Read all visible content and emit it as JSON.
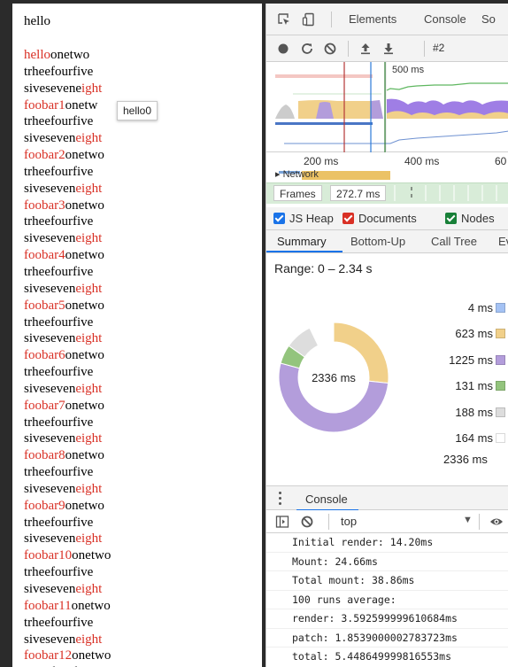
{
  "page": {
    "title": "hello",
    "lines": [
      {
        "parts": [
          {
            "text": "hello",
            "red": true
          },
          {
            "text": "onetwo",
            "red": false
          }
        ]
      },
      {
        "parts": [
          {
            "text": "trheefourfive",
            "red": false
          }
        ]
      },
      {
        "parts": [
          {
            "text": "sivesevene",
            "red": false
          },
          {
            "text": "ight",
            "red": true
          }
        ]
      },
      {
        "parts": [
          {
            "text": "foobar1",
            "red": true
          },
          {
            "text": "onetw",
            "red": false
          }
        ]
      },
      {
        "parts": [
          {
            "text": "trheefourfive",
            "red": false
          }
        ]
      },
      {
        "parts": [
          {
            "text": "siveseven",
            "red": false
          },
          {
            "text": "eight",
            "red": true
          }
        ]
      },
      {
        "parts": [
          {
            "text": "foobar2",
            "red": true
          },
          {
            "text": "onetwo",
            "red": false
          }
        ]
      },
      {
        "parts": [
          {
            "text": "trheefourfive",
            "red": false
          }
        ]
      },
      {
        "parts": [
          {
            "text": "siveseven",
            "red": false
          },
          {
            "text": "eight",
            "red": true
          }
        ]
      },
      {
        "parts": [
          {
            "text": "foobar3",
            "red": true
          },
          {
            "text": "onetwo",
            "red": false
          }
        ]
      },
      {
        "parts": [
          {
            "text": "trheefourfive",
            "red": false
          }
        ]
      },
      {
        "parts": [
          {
            "text": "siveseven",
            "red": false
          },
          {
            "text": "eight",
            "red": true
          }
        ]
      },
      {
        "parts": [
          {
            "text": "foobar4",
            "red": true
          },
          {
            "text": "onetwo",
            "red": false
          }
        ]
      },
      {
        "parts": [
          {
            "text": "trheefourfive",
            "red": false
          }
        ]
      },
      {
        "parts": [
          {
            "text": "siveseven",
            "red": false
          },
          {
            "text": "eight",
            "red": true
          }
        ]
      },
      {
        "parts": [
          {
            "text": "foobar5",
            "red": true
          },
          {
            "text": "onetwo",
            "red": false
          }
        ]
      },
      {
        "parts": [
          {
            "text": "trheefourfive",
            "red": false
          }
        ]
      },
      {
        "parts": [
          {
            "text": "siveseven",
            "red": false
          },
          {
            "text": "eight",
            "red": true
          }
        ]
      },
      {
        "parts": [
          {
            "text": "foobar6",
            "red": true
          },
          {
            "text": "onetwo",
            "red": false
          }
        ]
      },
      {
        "parts": [
          {
            "text": "trheefourfive",
            "red": false
          }
        ]
      },
      {
        "parts": [
          {
            "text": "siveseven",
            "red": false
          },
          {
            "text": "eight",
            "red": true
          }
        ]
      },
      {
        "parts": [
          {
            "text": "foobar7",
            "red": true
          },
          {
            "text": "onetwo",
            "red": false
          }
        ]
      },
      {
        "parts": [
          {
            "text": "trheefourfive",
            "red": false
          }
        ]
      },
      {
        "parts": [
          {
            "text": "siveseven",
            "red": false
          },
          {
            "text": "eight",
            "red": true
          }
        ]
      },
      {
        "parts": [
          {
            "text": "foobar8",
            "red": true
          },
          {
            "text": "onetwo",
            "red": false
          }
        ]
      },
      {
        "parts": [
          {
            "text": "trheefourfive",
            "red": false
          }
        ]
      },
      {
        "parts": [
          {
            "text": "siveseven",
            "red": false
          },
          {
            "text": "eight",
            "red": true
          }
        ]
      },
      {
        "parts": [
          {
            "text": "foobar9",
            "red": true
          },
          {
            "text": "onetwo",
            "red": false
          }
        ]
      },
      {
        "parts": [
          {
            "text": "trheefourfive",
            "red": false
          }
        ]
      },
      {
        "parts": [
          {
            "text": "siveseven",
            "red": false
          },
          {
            "text": "eight",
            "red": true
          }
        ]
      },
      {
        "parts": [
          {
            "text": "foobar10",
            "red": true
          },
          {
            "text": "onetwo",
            "red": false
          }
        ]
      },
      {
        "parts": [
          {
            "text": "trheefourfive",
            "red": false
          }
        ]
      },
      {
        "parts": [
          {
            "text": "siveseven",
            "red": false
          },
          {
            "text": "eight",
            "red": true
          }
        ]
      },
      {
        "parts": [
          {
            "text": "foobar11",
            "red": true
          },
          {
            "text": "onetwo",
            "red": false
          }
        ]
      },
      {
        "parts": [
          {
            "text": "trheefourfive",
            "red": false
          }
        ]
      },
      {
        "parts": [
          {
            "text": "siveseven",
            "red": false
          },
          {
            "text": "eight",
            "red": true
          }
        ]
      },
      {
        "parts": [
          {
            "text": "foobar12",
            "red": true
          },
          {
            "text": "onetwo",
            "red": false
          }
        ]
      },
      {
        "parts": [
          {
            "text": "trheefourfive",
            "red": false
          }
        ]
      }
    ],
    "tooltip": "hello0",
    "red_color": "#d93025"
  },
  "devtools": {
    "tabs": [
      "Elements",
      "Console",
      "So"
    ],
    "icons": [
      "inspect-element-icon",
      "device-toolbar-icon"
    ],
    "perf_toolbar": {
      "icons": [
        "record-icon",
        "reload-icon",
        "clear-icon",
        "upload-icon",
        "download-icon"
      ],
      "recording_label": "#2"
    },
    "overview": {
      "label": "500 ms"
    },
    "ruler": [
      "200 ms",
      "400 ms",
      "60"
    ],
    "network_label": "Network",
    "frames": {
      "label": "Frames",
      "value": "272.7 ms"
    },
    "checkboxes": [
      {
        "label": "JS Heap",
        "color": "#1a73e8"
      },
      {
        "label": "Documents",
        "color": "#d93025"
      },
      {
        "label": "Nodes",
        "color": "#188038"
      }
    ],
    "subtabs": [
      "Summary",
      "Bottom-Up",
      "Call Tree",
      "Ev"
    ],
    "summary": {
      "range": "Range: 0 – 2.34 s",
      "total_center": "2336 ms",
      "legend": [
        {
          "value": "4 ms",
          "ms": 4,
          "color": "#a4c2f4"
        },
        {
          "value": "623 ms",
          "ms": 623,
          "color": "#f1d08a"
        },
        {
          "value": "1225 ms",
          "ms": 1225,
          "color": "#b39ddb"
        },
        {
          "value": "131 ms",
          "ms": 131,
          "color": "#93c47d"
        },
        {
          "value": "188 ms",
          "ms": 188,
          "color": "#dddddd"
        },
        {
          "value": "164 ms",
          "ms": 164,
          "color": "#ffffff"
        }
      ],
      "total": "2336 ms"
    },
    "console": {
      "tab": "Console",
      "context": "top",
      "toolbar_icons": [
        "sidebar-toggle-icon",
        "clear-console-icon",
        "eye-icon"
      ],
      "logs": [
        "Initial render: 14.20ms",
        "Mount: 24.66ms",
        "Total mount: 38.86ms",
        "100 runs average:",
        "render: 3.592599999610684ms",
        "patch: 1.8539000002783723ms",
        "total: 5.448649999816553ms"
      ]
    }
  }
}
